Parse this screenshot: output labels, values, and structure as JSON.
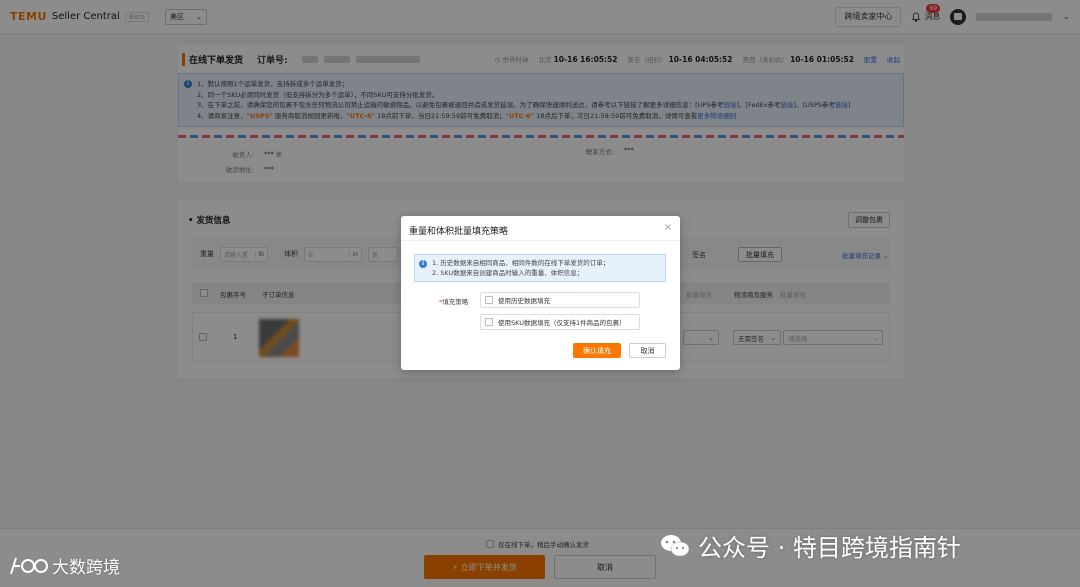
{
  "topbar": {
    "brand": "TEMU",
    "app_name": "Seller Central",
    "beta": "Beta",
    "region": "美区",
    "cross_border": "跨境卖家中心",
    "messages_label": "消息",
    "messages_count": "69"
  },
  "order": {
    "title": "在线下单发货",
    "order_label": "订单号:",
    "world_time_label": "世界时钟",
    "times": [
      {
        "zone": "北京",
        "value": "10-16 16:05:52"
      },
      {
        "zone": "美东（纽约）",
        "value": "10-16 04:05:52"
      },
      {
        "zone": "美西（洛杉矶）",
        "value": "10-16 01:05:52"
      }
    ],
    "config_link": "配置",
    "collapse_link": "收起"
  },
  "notice": {
    "line1": "1、默认按照1个运单发货，支持拆成多个运单发货；",
    "line2": "2、同一个SKU必须同时发货（但支持拆分为多个运单），不同SKU可支持分批发货。",
    "line3": "3、在下单之前，请确保您的包裹不包含任何物流公司禁止运输的敏感物品，以避免包裹被退回并造成发货延误。为了确保快速顺利送达，请参考以下链接了解更多详细信息：[UPS参考",
    "line3_link1": "链接",
    "line3_mid1": "]、[FedEx参考",
    "line3_link2": "链接",
    "line3_mid2": "]、[USPS参考",
    "line3_link3": "链接",
    "line3_end": "]",
    "line4_a": "4、请商家注意，",
    "line4_ups": "\"USPS\"",
    "line4_b": "服务商取消规则更新啦，",
    "line4_utc6": "\"UTC-6\"",
    "line4_c": "18点前下单，当日21:59:59前可免费取消；",
    "line4_utc6b": "\"UTC-6\"",
    "line4_d": "18点后下单，次日21:59:59前可免费取消，详情可查看",
    "line4_link": "更多物流细则"
  },
  "address": {
    "receiver_label": "收货人:",
    "receiver_value": "*** ◎",
    "addr_label": "收货地址:",
    "addr_value": "***",
    "contact_label": "联系方式:",
    "contact_value": "***"
  },
  "shipping": {
    "title": "发货信息",
    "adjust_btn": "调整包裹",
    "weight_label": "重量",
    "weight_placeholder": "请输入重",
    "weight_unit": "lb",
    "volume_label": "体积",
    "length_placeholder": "长",
    "length_unit": "in",
    "width_placeholder": "宽",
    "batch_fill_btn": "批量填充",
    "batch_record_link": "批量填充记录 ⌄",
    "sign_label": "签名",
    "col_pkg": "包裹序号",
    "col_sub": "子订单信息",
    "col_batch": "批量填充",
    "col_logistics": "物流商及服务",
    "col_logistics_batch": "批量填充",
    "row_index": "1",
    "row_sign": "无需签名",
    "row_select": "请选择"
  },
  "dialog": {
    "title": "重量和体积批量填充策略",
    "close": "×",
    "info1": "1. 历史数据来自相同商品、相同件数的在线下单发货的订单；",
    "info2": "2. SKU数据来自创建商品时输入的重量、体积信息；",
    "strategy_label": "填充策略",
    "option1": "使用历史数据填充",
    "option2": "使用SKU数据填充（仅支持1件商品的包裹）",
    "confirm": "确认填充",
    "cancel": "取消"
  },
  "bottom": {
    "check_label": "仅在线下单，稍后手动确认发货",
    "primary": "立即下单并发货",
    "cancel": "取消"
  },
  "watermark": {
    "left": "大数跨境",
    "right": "公众号 · 特目跨境指南针"
  }
}
